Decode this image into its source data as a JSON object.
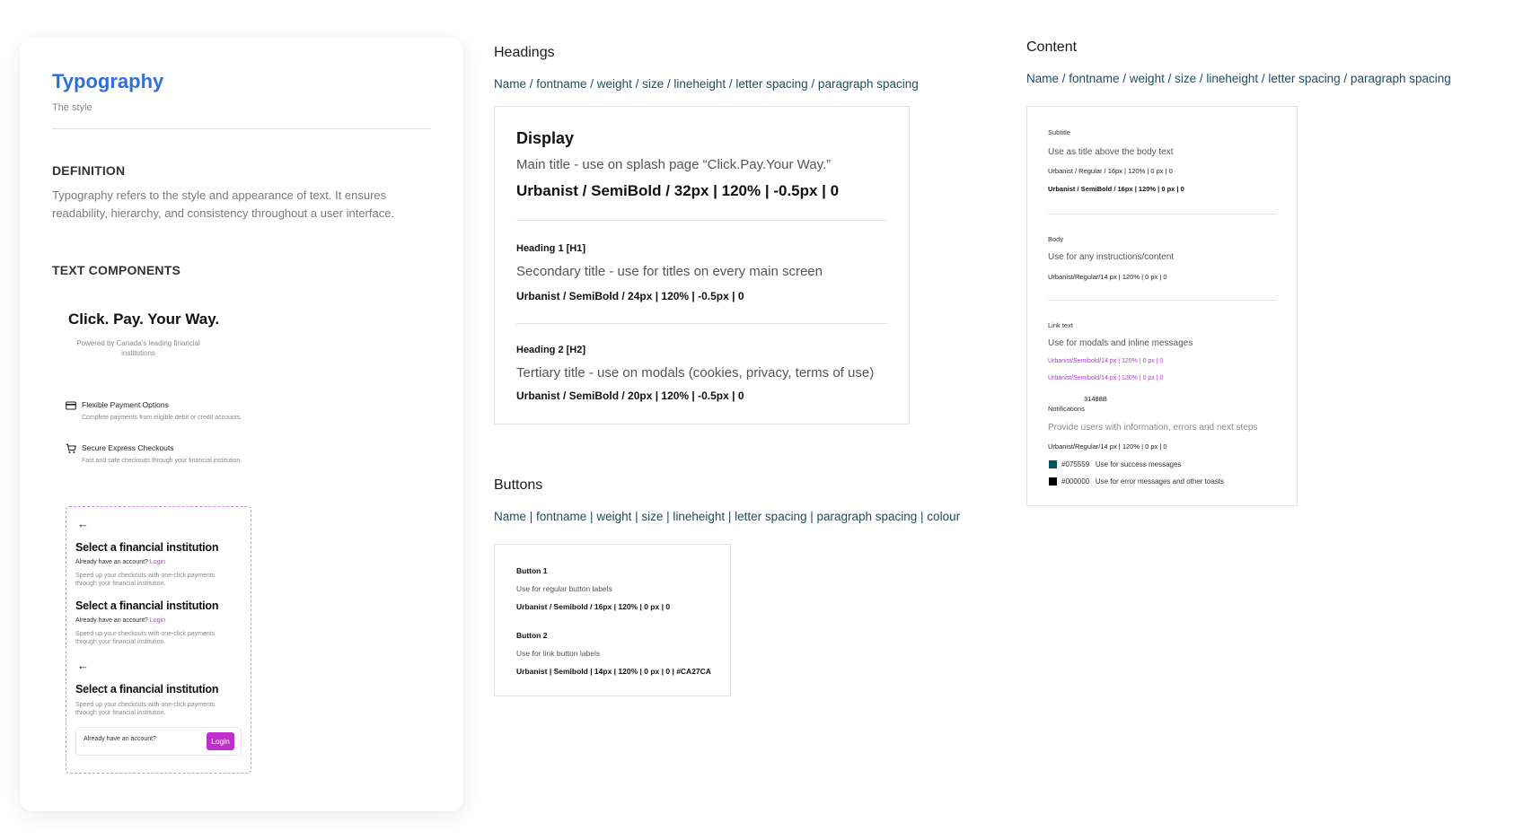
{
  "typography": {
    "title": "Typography",
    "subtitle": "The style",
    "definition_heading": "DEFINITION",
    "definition_text": "Typography refers to the style and appearance of text. It ensures readability, hierarchy, and consistency throughout a user interface.",
    "components_heading": "TEXT COMPONENTS"
  },
  "preview": {
    "headline": "Click. Pay. Your Way.",
    "powered_by": "Powered by Canada's leading financial institutions",
    "features": [
      {
        "icon": "credit-card-icon",
        "title": "Flexible Payment Options",
        "desc": "Complete payments from eligible debit or credit accounts."
      },
      {
        "icon": "cart-icon",
        "title": "Secure Express Checkouts",
        "desc": "Fast and safe checkouts through your financial institution."
      }
    ],
    "modal": {
      "arrow_glyph": "←",
      "title": "Select a financial institution",
      "already": "Already have an account?",
      "login": "Login",
      "speed": "Speed up your checkouts with one-click payments through your financial institution.",
      "login_button": "Login"
    }
  },
  "headings": {
    "title": "Headings",
    "spec": "Name / fontname / weight / size / lineheight / letter spacing / paragraph spacing",
    "items": [
      {
        "label": "Display",
        "desc": "Main title - use on splash page “Click.Pay.Your Way.”",
        "spec": "Urbanist / SemiBold / 32px | 120% | -0.5px | 0"
      },
      {
        "label": "Heading 1 [H1]",
        "desc": "Secondary title - use for titles on every main screen",
        "spec": "Urbanist / SemiBold / 24px | 120% | -0.5px | 0"
      },
      {
        "label": "Heading 2 [H2]",
        "desc": "Tertiary title - use on modals (cookies, privacy, terms of use)",
        "spec": "Urbanist / SemiBold / 20px | 120% | -0.5px | 0"
      }
    ]
  },
  "buttons": {
    "title": "Buttons",
    "spec": "Name | fontname | weight | size | lineheight | letter spacing | paragraph spacing | colour",
    "items": [
      {
        "label": "Button 1",
        "desc": "Use for regular button labels",
        "spec": "Urbanist / Semibold / 16px | 120% | 0 px | 0"
      },
      {
        "label": "Button 2",
        "desc": "Use for link button labels",
        "spec": "Urbanist | Semibold | 14px | 120% | 0 px | 0 | #CA27CA"
      }
    ]
  },
  "content": {
    "title": "Content",
    "spec": "Name / fontname / weight / size / lineheight / letter spacing / paragraph spacing",
    "subtitle": {
      "label": "Subtitle",
      "desc": "Use as title above the body text",
      "spec_regular": "Urbanist / Regular / 16px | 120% | 0 px | 0",
      "spec_bold": "Urbanist / SemiBold / 16px | 120% | 0 px | 0"
    },
    "body": {
      "label": "Body",
      "desc": "Use for any instructions/content",
      "spec": "Urbanist/Regular/14 px | 120% | 0 px | 0"
    },
    "link": {
      "label": "Link text",
      "desc": "Use for modals and inline messages",
      "spec_1": "Urbanist/Semibold/14 px | 120% | 0 px | 0",
      "spec_2": "Urbanist/Semibold/14 px | 120% | 0 px | 0",
      "code": "31488B"
    },
    "notifications": {
      "label": "Notifications",
      "desc": "Provide users with information, errors and next steps",
      "spec": "Urbanist/Regular/14 px | 120% | 0 px | 0",
      "swatches": [
        {
          "hex": "#075559",
          "text": "Use for success messages",
          "color": "#075559"
        },
        {
          "hex": "#000000",
          "text": "Use for error messages and other toasts",
          "color": "#000000"
        }
      ]
    }
  }
}
